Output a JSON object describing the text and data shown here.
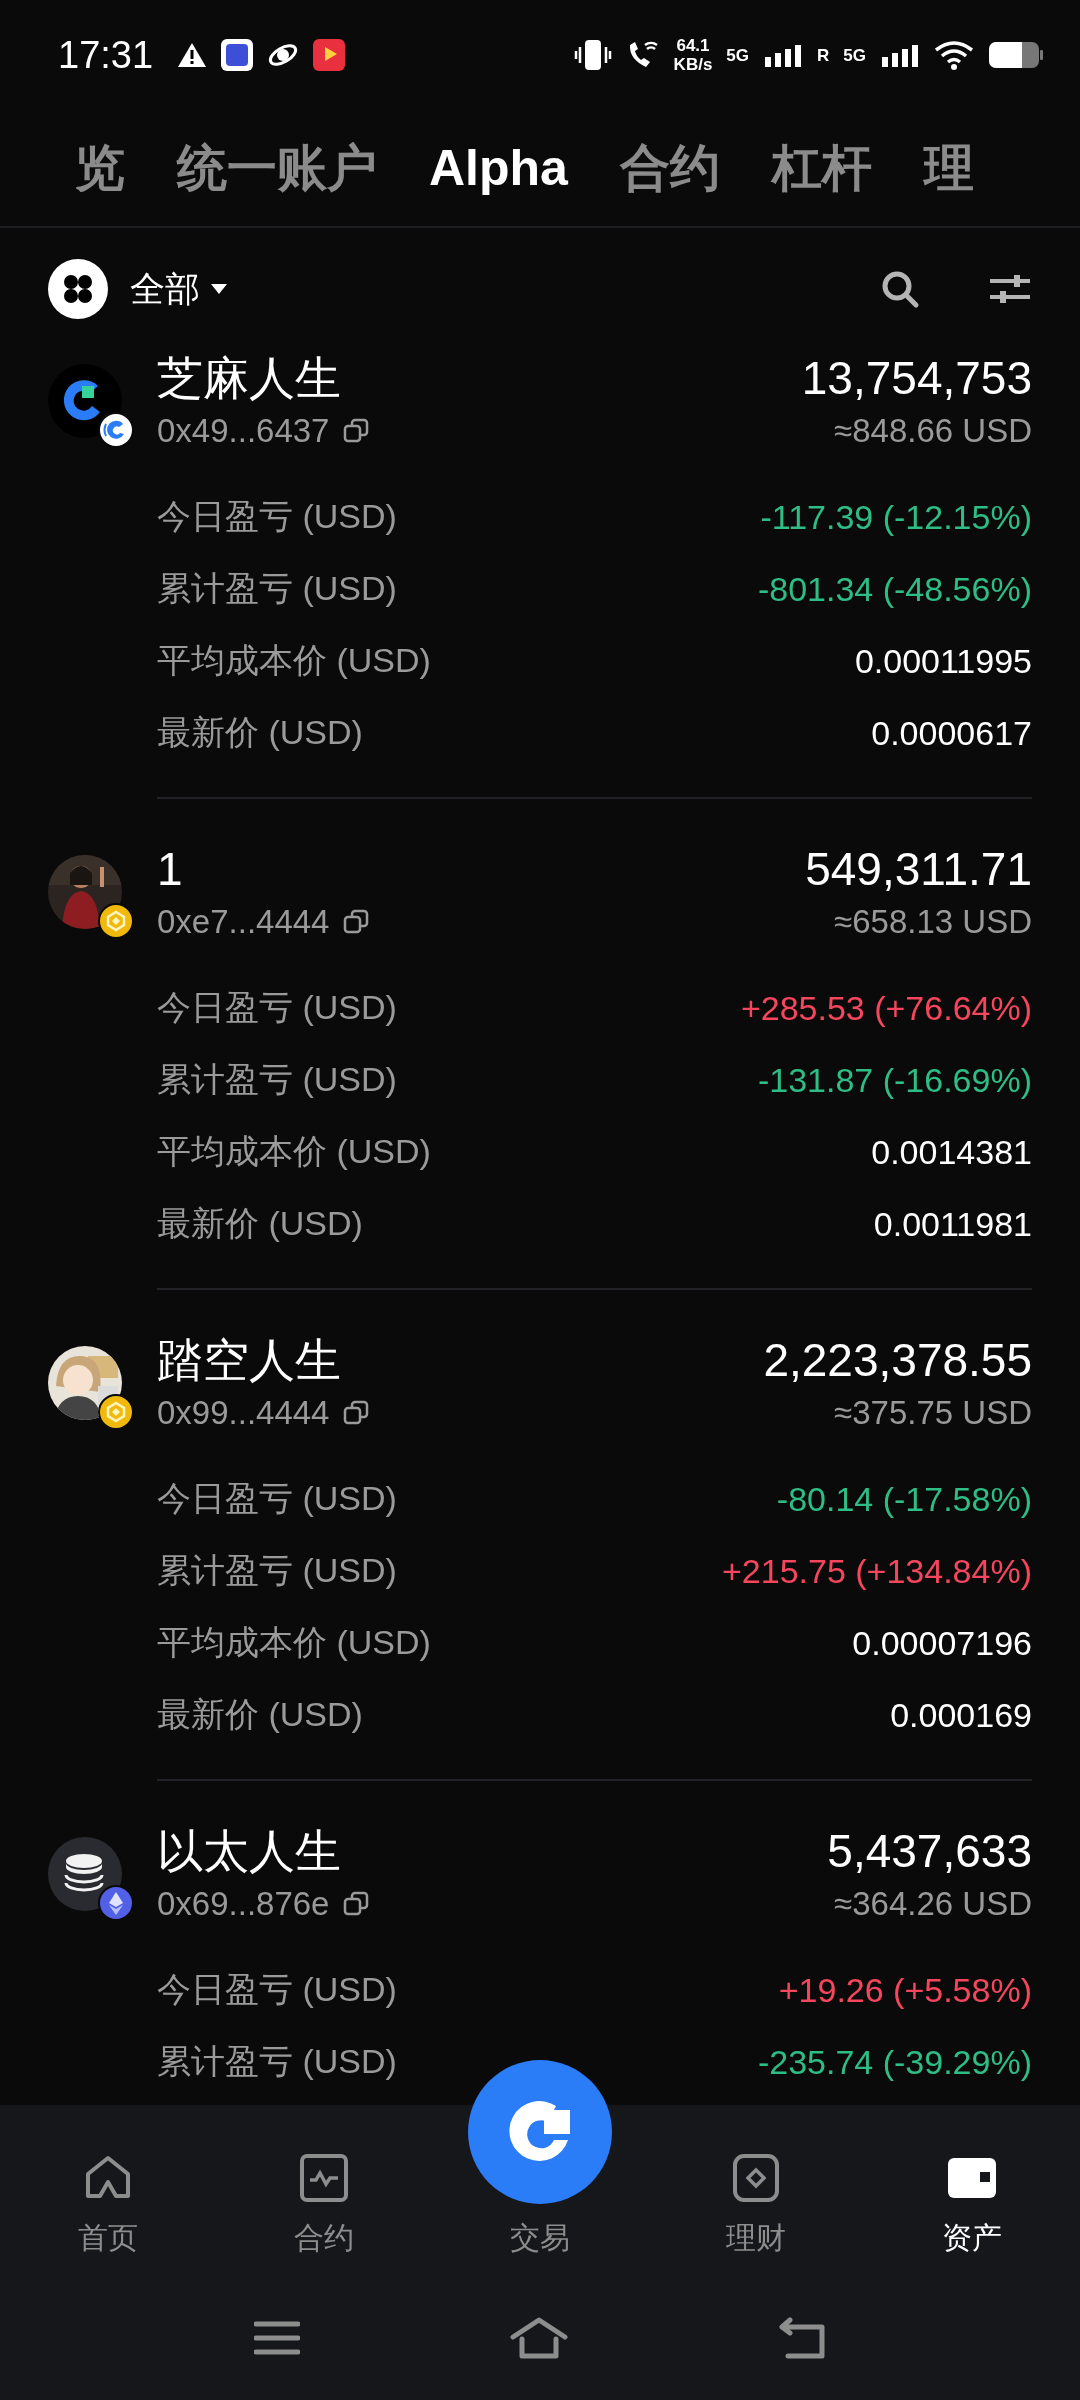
{
  "status_bar": {
    "time": "17:31",
    "net_speed": "64.1",
    "net_unit": "KB/s",
    "sim1": "5G",
    "roaming": "R",
    "sim2": "5G"
  },
  "tabs": [
    {
      "label": "览",
      "selected": false
    },
    {
      "label": "统一账户",
      "selected": false
    },
    {
      "label": "Alpha",
      "selected": true
    },
    {
      "label": "合约",
      "selected": false
    },
    {
      "label": "杠杆",
      "selected": false
    },
    {
      "label": "理",
      "selected": false
    }
  ],
  "filter": {
    "label": "全部"
  },
  "assets": [
    {
      "name": "芝麻人生",
      "address": "0x49...6437",
      "amount": "13,754,753",
      "usd_value": "≈848.66 USD",
      "kind": "logo",
      "metrics": [
        {
          "label": "今日盈亏 (USD)",
          "value": "-117.39 (-12.15%)",
          "color": "#2ebd85"
        },
        {
          "label": "累计盈亏 (USD)",
          "value": "-801.34 (-48.56%)",
          "color": "#2ebd85"
        },
        {
          "label": "平均成本价 (USD)",
          "value": "0.00011995",
          "color": "#ffffff"
        },
        {
          "label": "最新价 (USD)",
          "value": "0.0000617",
          "color": "#ffffff"
        }
      ]
    },
    {
      "name": "1",
      "address": "0xe7...4444",
      "amount": "549,311.71",
      "usd_value": "≈658.13 USD",
      "metrics": [
        {
          "label": "今日盈亏 (USD)",
          "value": "+285.53 (+76.64%)",
          "color": "#f6465d"
        },
        {
          "label": "累计盈亏 (USD)",
          "value": "-131.87 (-16.69%)",
          "color": "#2ebd85"
        },
        {
          "label": "平均成本价 (USD)",
          "value": "0.0014381",
          "color": "#ffffff"
        },
        {
          "label": "最新价 (USD)",
          "value": "0.0011981",
          "color": "#ffffff"
        }
      ]
    },
    {
      "name": "踏空人生",
      "address": "0x99...4444",
      "amount": "2,223,378.55",
      "usd_value": "≈375.75 USD",
      "kind": "cartoon",
      "metrics": [
        {
          "label": "今日盈亏 (USD)",
          "value": "-80.14 (-17.58%)",
          "color": "#2ebd85"
        },
        {
          "label": "累计盈亏 (USD)",
          "value": "+215.75 (+134.84%)",
          "color": "#f6465d"
        },
        {
          "label": "平均成本价 (USD)",
          "value": "0.00007196",
          "color": "#ffffff"
        },
        {
          "label": "最新价 (USD)",
          "value": "0.000169",
          "color": "#ffffff"
        }
      ]
    },
    {
      "name": "以太人生",
      "address": "0x69...876e",
      "amount": "5,437,633",
      "usd_value": "≈364.26 USD",
      "kind": "coins",
      "metrics": [
        {
          "label": "今日盈亏 (USD)",
          "value": "+19.26 (+5.58%)",
          "color": "#f6465d"
        },
        {
          "label": "累计盈亏 (USD)",
          "value": "-235.74 (-39.29%)",
          "color": "#2ebd85"
        }
      ]
    }
  ],
  "bottom_nav": [
    {
      "label": "首页",
      "selected": false
    },
    {
      "label": "合约",
      "selected": false
    },
    {
      "label": "交易",
      "selected": false
    },
    {
      "label": "理财",
      "selected": false
    },
    {
      "label": "资产",
      "selected": true
    }
  ]
}
